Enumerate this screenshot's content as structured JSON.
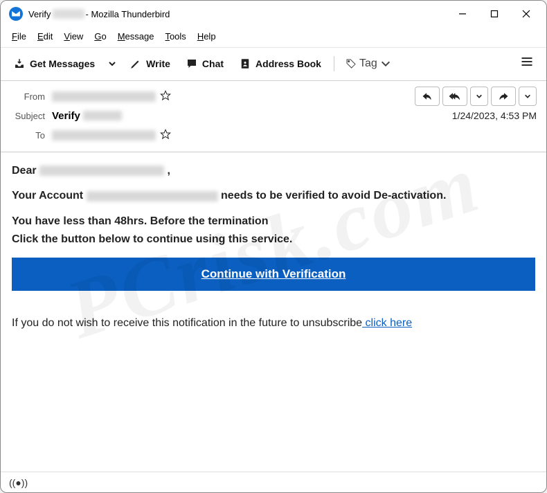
{
  "window": {
    "title_prefix": "Verify ",
    "title_suffix": " - Mozilla Thunderbird"
  },
  "menubar": [
    "File",
    "Edit",
    "View",
    "Go",
    "Message",
    "Tools",
    "Help"
  ],
  "toolbar": {
    "get_messages": "Get Messages",
    "write": "Write",
    "chat": "Chat",
    "address_book": "Address Book",
    "tag": "Tag"
  },
  "header": {
    "from_label": "From",
    "subject_label": "Subject",
    "to_label": "To",
    "subject_prefix": "Verify ",
    "date": "1/24/2023, 4:53 PM"
  },
  "body": {
    "greet_prefix": "Dear ",
    "greet_suffix": " ,",
    "line2_a": "Your Account ",
    "line2_b": " needs to be verified to avoid De-activation.",
    "line3": "You have less than 48hrs.  Before the termination",
    "line4": "Click the button below to continue using this service.",
    "cta": "Continue with Verification",
    "unsub_text": "If you do not wish to receive this notification in the future to unsubscribe",
    "unsub_link": "  click here"
  },
  "status": {
    "indicator": "((●))"
  },
  "watermark": "PCrisk.com"
}
